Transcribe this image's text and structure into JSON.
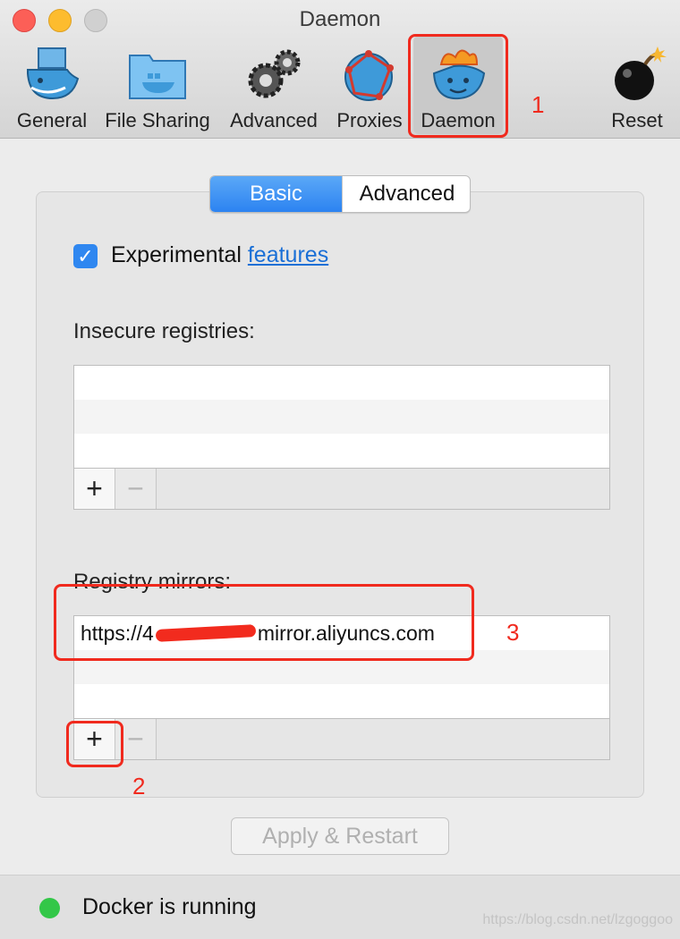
{
  "window": {
    "title": "Daemon"
  },
  "toolbar": {
    "items": [
      {
        "label": "General",
        "icon": "whale-container-icon"
      },
      {
        "label": "File Sharing",
        "icon": "folder-whale-icon"
      },
      {
        "label": "Advanced",
        "icon": "gears-icon"
      },
      {
        "label": "Proxies",
        "icon": "whale-network-icon"
      },
      {
        "label": "Daemon",
        "icon": "whale-fire-icon",
        "selected": true
      },
      {
        "label": "Reset",
        "icon": "bomb-icon"
      }
    ]
  },
  "tabs": {
    "basic": "Basic",
    "advanced": "Advanced",
    "active": "Basic"
  },
  "experimental": {
    "checked": true,
    "label": "Experimental",
    "link": "features"
  },
  "insecure_registries": {
    "label": "Insecure registries:",
    "items": []
  },
  "registry_mirrors": {
    "label": "Registry mirrors:",
    "items": [
      {
        "prefix": "https://4",
        "suffix": "mirror.aliyuncs.com"
      }
    ]
  },
  "list_buttons": {
    "add": "+",
    "remove": "−"
  },
  "apply_button": "Apply & Restart",
  "status": {
    "text": "Docker is running",
    "color": "#33c748"
  },
  "annotations": {
    "one": "1",
    "two": "2",
    "three": "3"
  },
  "watermark": "https://blog.csdn.net/lzgoggoo",
  "colors": {
    "accent": "#2f87f0",
    "annotation": "#f02a1e",
    "link": "#1a6fd6"
  }
}
